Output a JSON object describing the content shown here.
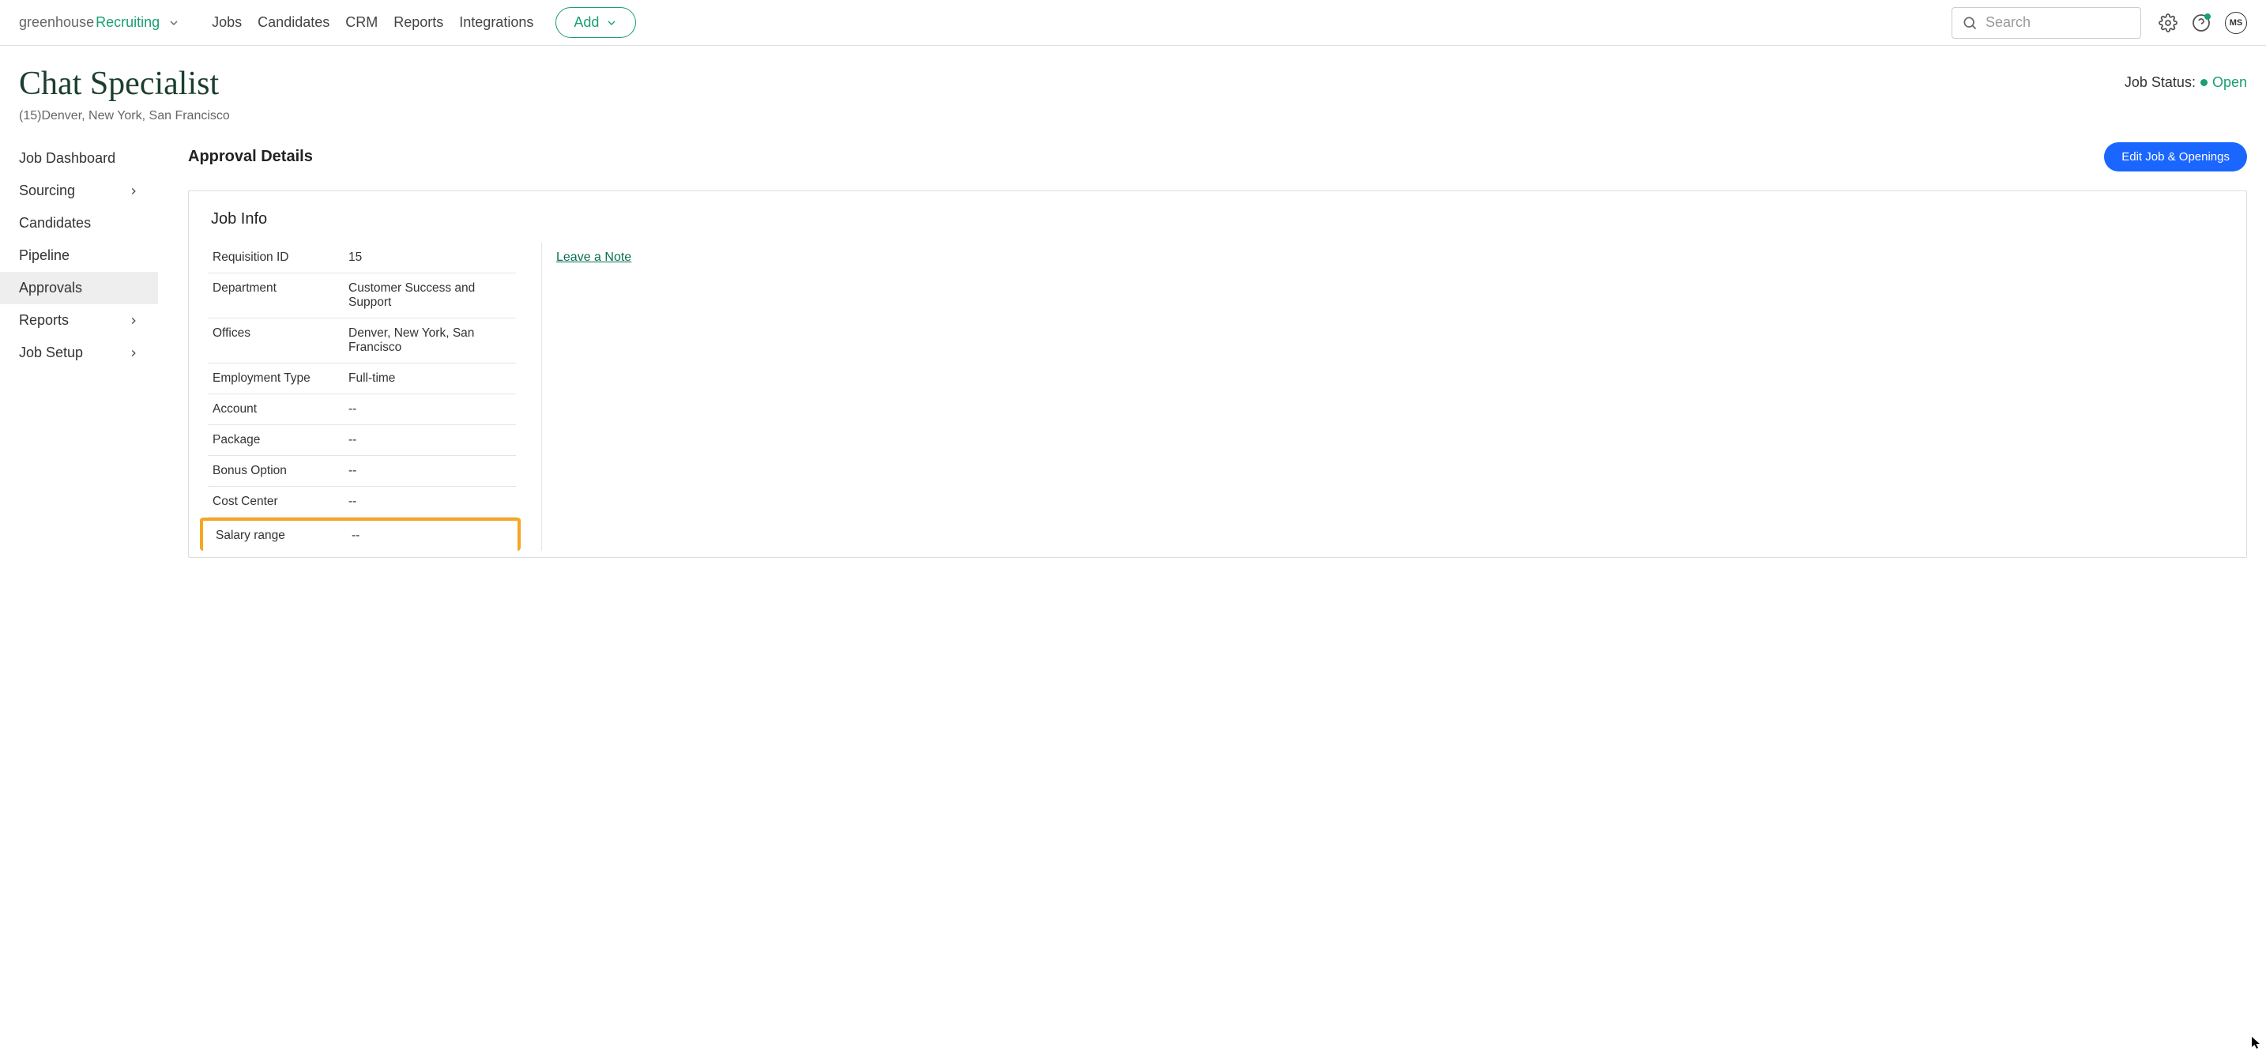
{
  "logo": {
    "part1": "greenhouse",
    "part2": "Recruiting"
  },
  "nav": [
    "Jobs",
    "Candidates",
    "CRM",
    "Reports",
    "Integrations"
  ],
  "add_label": "Add",
  "search_placeholder": "Search",
  "avatar_initials": "MS",
  "header": {
    "title": "Chat Specialist",
    "subtitle": "(15)Denver, New York, San Francisco",
    "status_label": "Job Status:",
    "status_value": "Open"
  },
  "sidebar": [
    {
      "label": "Job Dashboard",
      "expandable": false,
      "active": false
    },
    {
      "label": "Sourcing",
      "expandable": true,
      "active": false
    },
    {
      "label": "Candidates",
      "expandable": false,
      "active": false
    },
    {
      "label": "Pipeline",
      "expandable": false,
      "active": false
    },
    {
      "label": "Approvals",
      "expandable": false,
      "active": true
    },
    {
      "label": "Reports",
      "expandable": true,
      "active": false
    },
    {
      "label": "Job Setup",
      "expandable": true,
      "active": false
    }
  ],
  "section_title": "Approval Details",
  "edit_button": "Edit Job & Openings",
  "panel_title": "Job Info",
  "job_info": [
    {
      "label": "Requisition ID",
      "value": "15"
    },
    {
      "label": "Department",
      "value": "Customer Success and Support"
    },
    {
      "label": "Offices",
      "value": "Denver, New York, San Francisco"
    },
    {
      "label": "Employment Type",
      "value": "Full-time"
    },
    {
      "label": "Account",
      "value": "--"
    },
    {
      "label": "Package",
      "value": "--"
    },
    {
      "label": "Bonus Option",
      "value": "--"
    },
    {
      "label": "Cost Center",
      "value": "--"
    },
    {
      "label": "Salary range",
      "value": "--",
      "highlight": true
    }
  ],
  "leave_note": "Leave a Note"
}
